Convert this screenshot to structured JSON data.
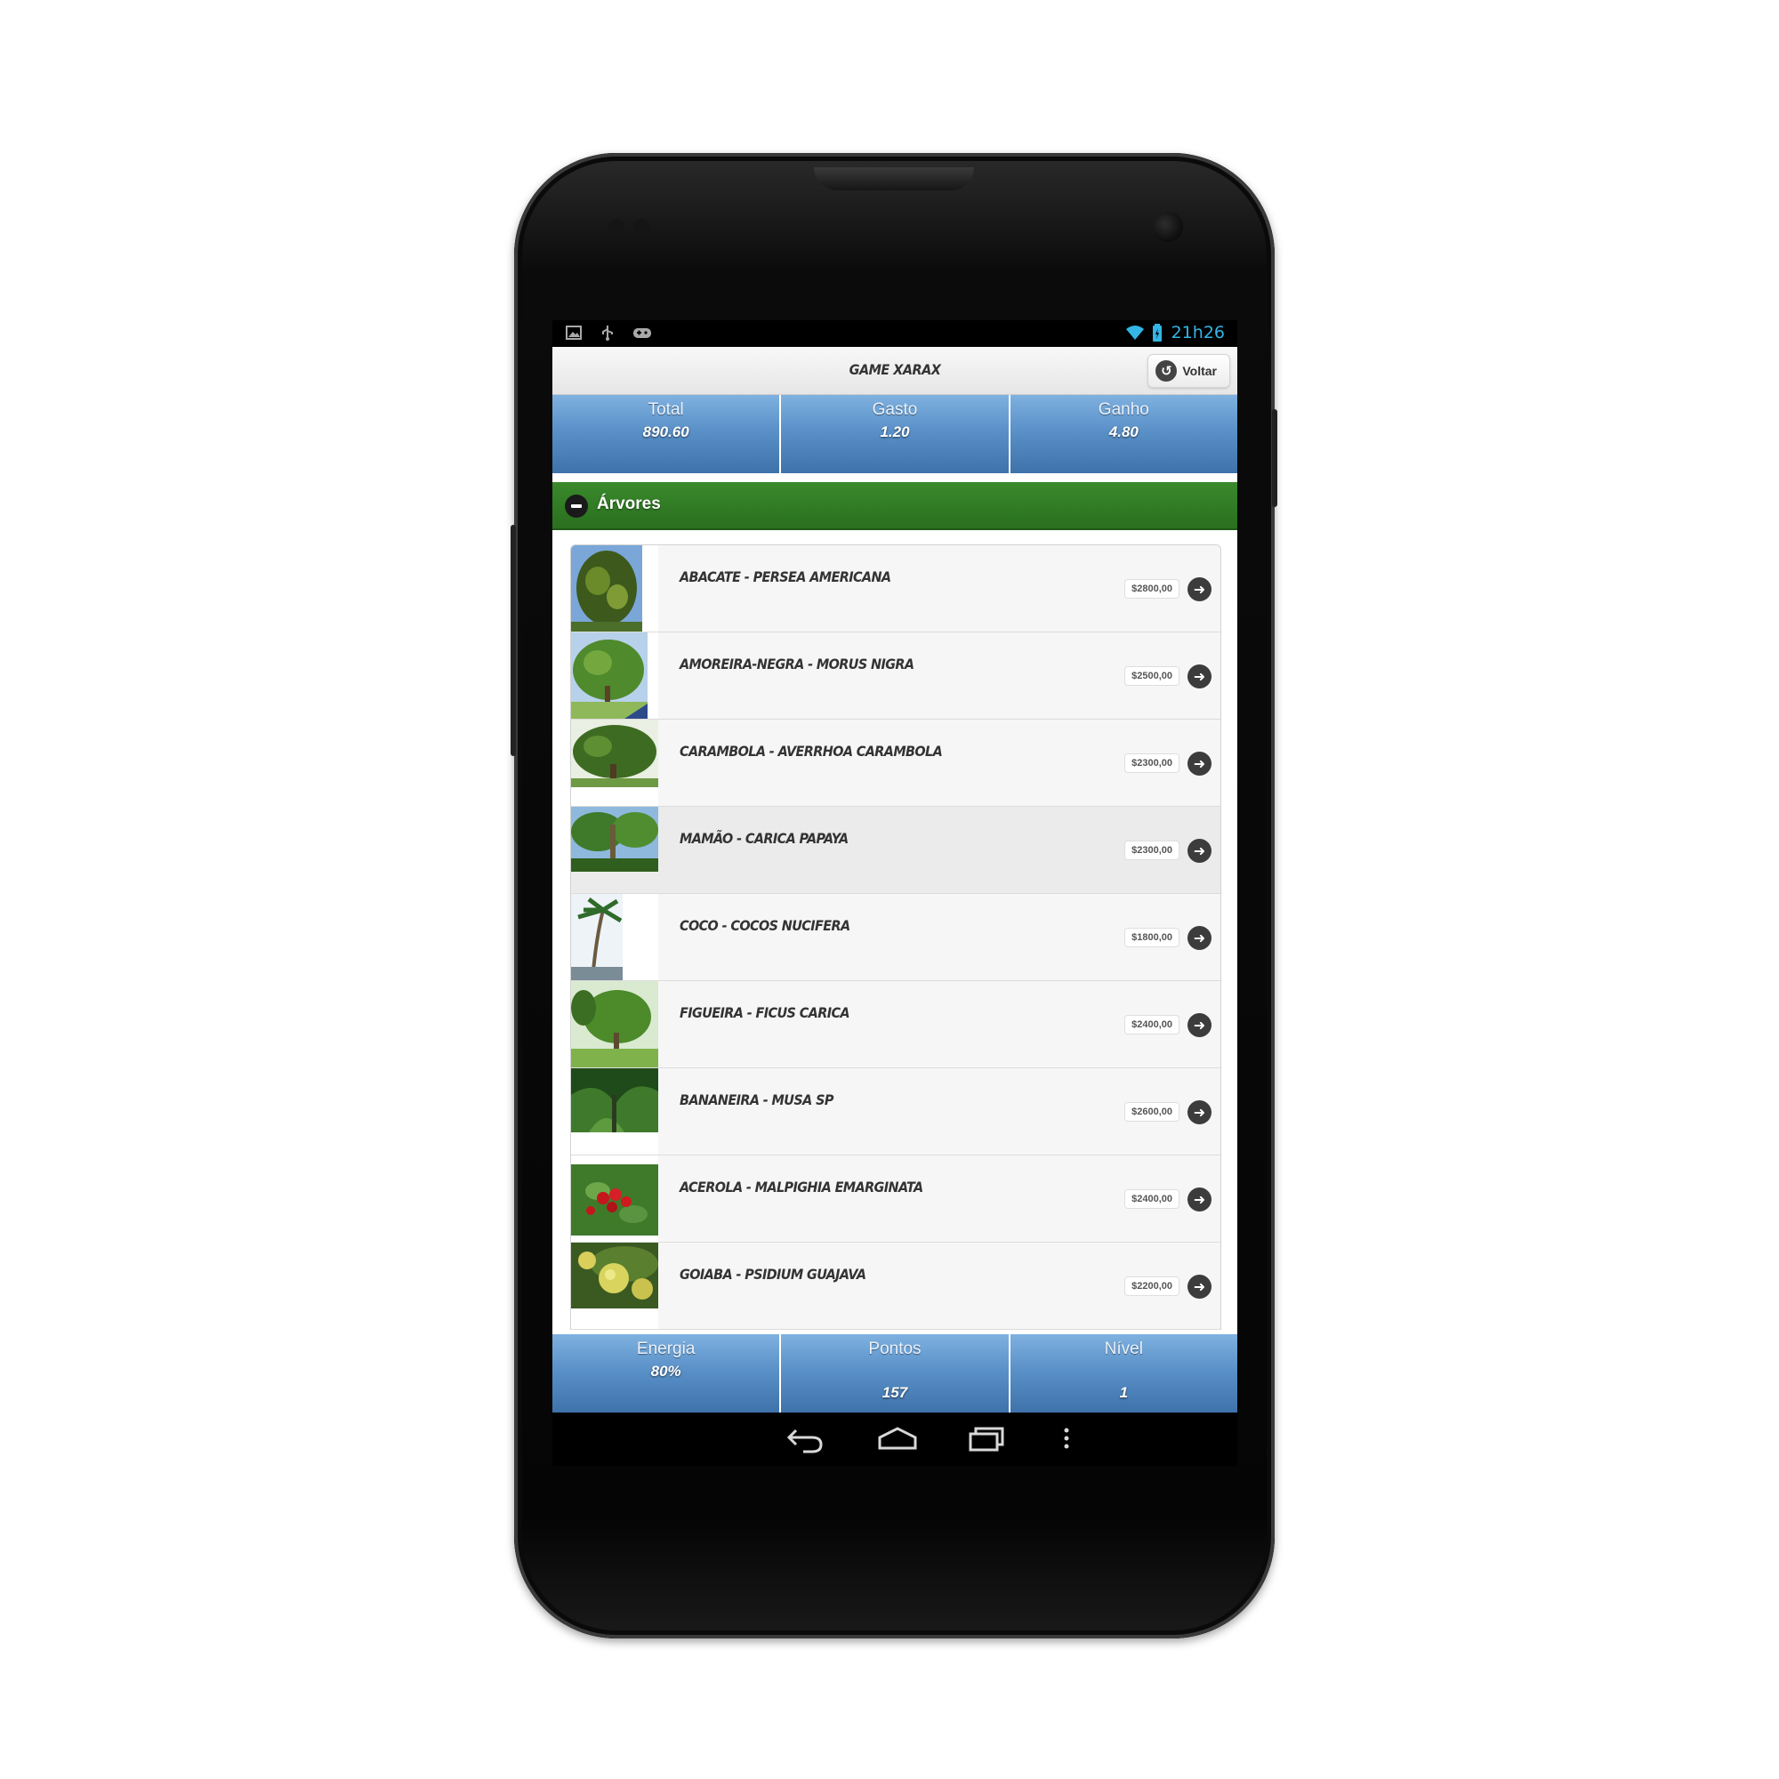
{
  "status_bar": {
    "left_icons": [
      "image-icon",
      "usb-icon",
      "gamepad-icon"
    ],
    "right_icons": [
      "wifi-icon",
      "battery-icon"
    ],
    "time": "21h26",
    "time_color": "#33b5e5"
  },
  "header": {
    "title": "GAME XARAX",
    "back_label": "Voltar"
  },
  "top_stats": [
    {
      "label": "Total",
      "value": "890.60"
    },
    {
      "label": "Gasto",
      "value": "1.20"
    },
    {
      "label": "Ganho",
      "value": "4.80"
    }
  ],
  "section": {
    "title": "Árvores",
    "color": "#2e7a22"
  },
  "trees": [
    {
      "name": "Abacate - Persea americana",
      "price": "$2800,00"
    },
    {
      "name": "Amoreira-negra - Morus nigra",
      "price": "$2500,00"
    },
    {
      "name": "Carambola - Averrhoa carambola",
      "price": "$2300,00"
    },
    {
      "name": "Mamão - Carica papaya",
      "price": "$2300,00"
    },
    {
      "name": "Coco - Cocos nucifera",
      "price": "$1800,00"
    },
    {
      "name": "Figueira - Ficus carica",
      "price": "$2400,00"
    },
    {
      "name": "Bananeira - Musa sp",
      "price": "$2600,00"
    },
    {
      "name": "Acerola - Malpighia emarginata",
      "price": "$2400,00"
    },
    {
      "name": "Goiaba - Psidium guajava",
      "price": "$2200,00"
    }
  ],
  "bottom_stats": [
    {
      "label": "Energia",
      "value": "80%"
    },
    {
      "label": "Pontos",
      "value": "157"
    },
    {
      "label": "Nível",
      "value": "1"
    }
  ],
  "nav_bar": [
    "back-icon",
    "home-icon",
    "recents-icon",
    "menu-icon"
  ],
  "accent_colors": {
    "stat_bar": "#5a91c8",
    "section_bar": "#2e7a22"
  }
}
